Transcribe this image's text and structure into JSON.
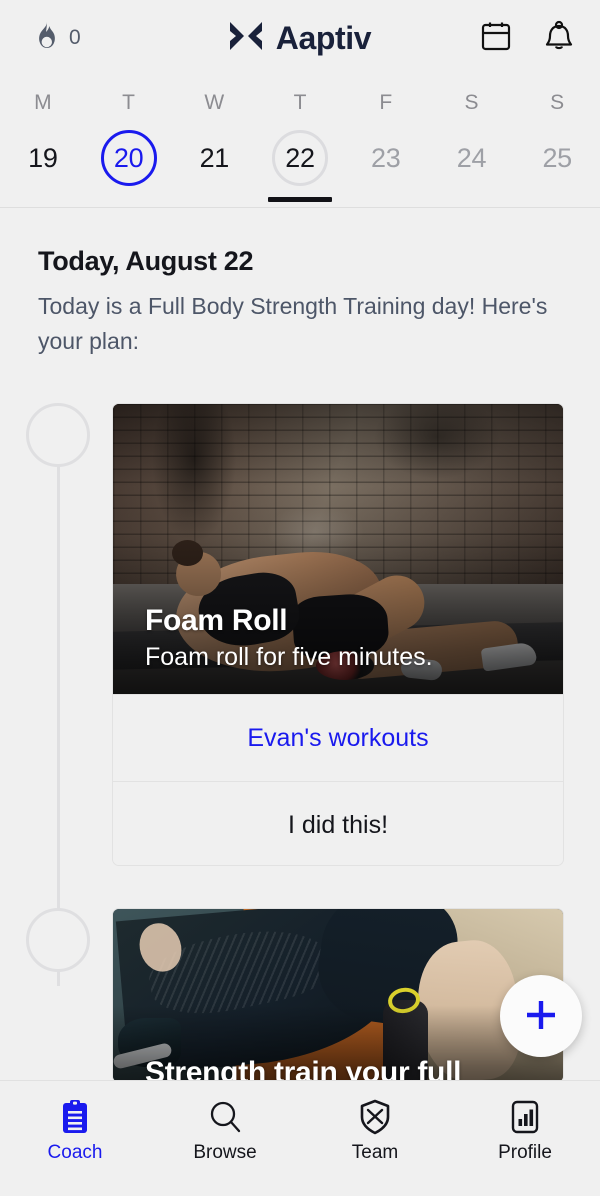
{
  "header": {
    "streak_count": "0",
    "streak_icon": "flame-icon",
    "brand_name": "Aaptiv",
    "brand_mark_icon": "aaptiv-x-logo-icon",
    "calendar_icon": "calendar-icon",
    "bell_icon": "bell-icon"
  },
  "date_strip": {
    "day_initials": [
      "M",
      "T",
      "W",
      "T",
      "F",
      "S",
      "S"
    ],
    "days": [
      {
        "num": "19",
        "state": "normal"
      },
      {
        "num": "20",
        "state": "ring-accent"
      },
      {
        "num": "21",
        "state": "normal"
      },
      {
        "num": "22",
        "state": "selected"
      },
      {
        "num": "23",
        "state": "muted"
      },
      {
        "num": "24",
        "state": "muted"
      },
      {
        "num": "25",
        "state": "muted"
      }
    ]
  },
  "today": {
    "title": "Today, August 22",
    "subtitle": "Today is a Full Body Strength Training day! Here's your plan:"
  },
  "cards": [
    {
      "title": "Foam Roll",
      "subtitle": "Foam roll for five minutes.",
      "link_label": "Evan's workouts",
      "done_label": "I did this!"
    },
    {
      "title": "Strength train your full"
    }
  ],
  "fab": {
    "icon": "plus-icon",
    "label": "+"
  },
  "tabbar": {
    "items": [
      {
        "label": "Coach",
        "icon": "clipboard-icon",
        "active": true
      },
      {
        "label": "Browse",
        "icon": "search-icon",
        "active": false
      },
      {
        "label": "Team",
        "icon": "shield-x-icon",
        "active": false
      },
      {
        "label": "Profile",
        "icon": "bar-chart-icon",
        "active": false
      }
    ]
  },
  "colors": {
    "accent_blue": "#1a1aee",
    "background": "#f0f0f0",
    "text_dark": "#15161c",
    "text_muted": "#9ea0a6",
    "brand_navy": "#19213a"
  }
}
